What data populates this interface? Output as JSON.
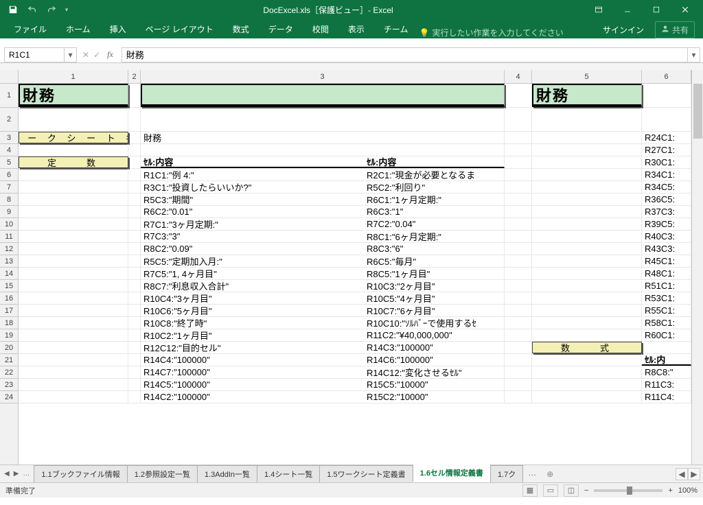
{
  "titlebar": {
    "title": "DocExcel.xls［保護ビュー］- Excel"
  },
  "ribbon": {
    "tabs": [
      "ファイル",
      "ホーム",
      "挿入",
      "ページ レイアウト",
      "数式",
      "データ",
      "校閲",
      "表示",
      "チーム"
    ],
    "tellme": "実行したい作業を入力してください",
    "signin": "サインイン",
    "share": "共有"
  },
  "namebox": "R1C1",
  "formula": "財務",
  "columns": [
    "1",
    "2",
    "3",
    "4",
    "5",
    "6"
  ],
  "rows": [
    "1",
    "2",
    "3",
    "4",
    "5",
    "6",
    "7",
    "8",
    "9",
    "10",
    "11",
    "12",
    "13",
    "14",
    "15",
    "16",
    "17",
    "18",
    "19",
    "20",
    "21",
    "22",
    "23",
    "24"
  ],
  "sheet": {
    "hdr_left": "財務",
    "hdr_right": "財務",
    "ws_label": "ワ ー ク シ ー ト 名",
    "ws_name": "財務",
    "const_label": "定　　数",
    "col_hdr_a": "ｾﾙ:内容",
    "col_hdr_b": "ｾﾙ:内容",
    "formula_label": "数　　式",
    "col_hdr_r": "ｾﾙ:内",
    "data": [
      {
        "a": "R1C1:\"例 4:\"",
        "b": "R2C1:\"現金が必要となるま",
        "r": "R24C1:"
      },
      {
        "a": "R3C1:\"投資したらいいか?\"",
        "b": "R5C2:\"利回り\"",
        "r": "R27C1:"
      },
      {
        "a": "R5C3:\"期間\"",
        "b": "R6C1:\"1ヶ月定期:\"",
        "r": "R30C1:"
      },
      {
        "a": "R6C2:\"0.01\"",
        "b": "R6C3:\"1\"",
        "r": "R34C1:"
      },
      {
        "a": "R7C1:\"3ヶ月定期:\"",
        "b": "R7C2:\"0.04\"",
        "r": "R34C5:"
      },
      {
        "a": "R7C3:\"3\"",
        "b": "R8C1:\"6ヶ月定期:\"",
        "r": "R36C5:"
      },
      {
        "a": "R8C2:\"0.09\"",
        "b": "R8C3:\"6\"",
        "r": "R37C3:"
      },
      {
        "a": "R5C5:\"定期加入月:\"",
        "b": "R6C5:\"毎月\"",
        "r": "R39C5:"
      },
      {
        "a": "R7C5:\"1, 4ヶ月目\"",
        "b": "R8C5:\"1ヶ月目\"",
        "r": "R40C3:"
      },
      {
        "a": "R8C7:\"利息収入合計\"",
        "b": "R10C3:\"2ヶ月目\"",
        "r": "R43C3:"
      },
      {
        "a": "R10C4:\"3ヶ月目\"",
        "b": "R10C5:\"4ヶ月目\"",
        "r": "R45C1:"
      },
      {
        "a": "R10C6:\"5ヶ月目\"",
        "b": "R10C7:\"6ヶ月目\"",
        "r": "R48C1:"
      },
      {
        "a": "R10C8:\"終了時\"",
        "b": "R10C10:\"ｿﾙﾊﾞｰで使用するｾ",
        "r": "R51C1:"
      },
      {
        "a": "R10C2:\"1ヶ月目\"",
        "b": "R11C2:\"¥40,000,000\"",
        "r": "R53C1:"
      },
      {
        "a": "R12C12:\"目的セル\"",
        "b": "R14C3:\"100000\"",
        "r": "R55C1:"
      },
      {
        "a": "R14C4:\"100000\"",
        "b": "R14C6:\"100000\"",
        "r": "R58C1:"
      },
      {
        "a": "R14C7:\"100000\"",
        "b": "R14C12:\"変化させるｾﾙ\"",
        "r": "R60C1:"
      },
      {
        "a": "R14C5:\"100000\"",
        "b": "R15C5:\"10000\"",
        "r": ""
      },
      {
        "a": "R14C2:\"100000\"",
        "b": "R15C2:\"10000\"",
        "r": "R8C8:\""
      }
    ],
    "right_rows_special": {
      "20": {
        "label": "数　　式"
      },
      "21": {
        "hdr": "ｾﾙ:内"
      },
      "22": "R8C8:\"",
      "23": "R11C3:",
      "24": "R11C4:"
    }
  },
  "tabs": [
    "1.1ブックファイル情報",
    "1.2参照設定一覧",
    "1.3AddIn一覧",
    "1.4シート一覧",
    "1.5ワークシート定義書",
    "1.6セル情報定義書",
    "1.7ク"
  ],
  "active_tab": 5,
  "status": {
    "ready": "準備完了",
    "zoom": "100%"
  }
}
